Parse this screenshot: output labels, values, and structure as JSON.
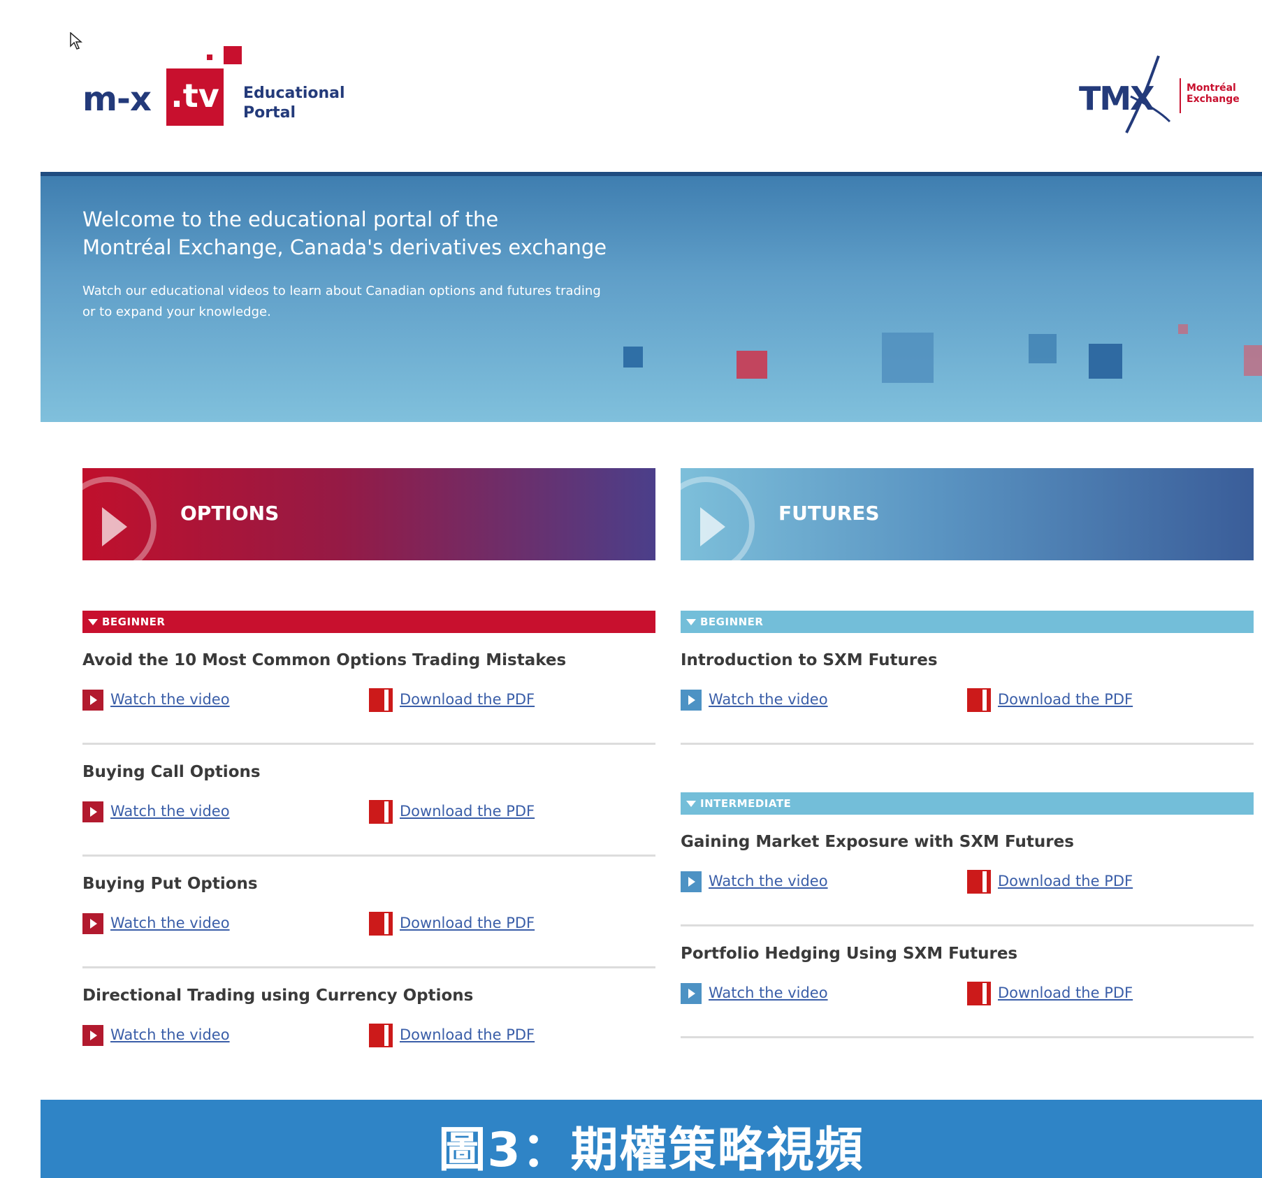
{
  "header": {
    "logo": {
      "main": "m-x",
      "tv": ".tv",
      "sub_line1": "Educational",
      "sub_line2": "Portal"
    },
    "tmx": {
      "main": "TMX",
      "sub_line1": "Montréal",
      "sub_line2": "Exchange"
    }
  },
  "hero": {
    "title_line1": "Welcome to the educational portal of the",
    "title_line2": "Montréal Exchange, Canada's derivatives exchange",
    "text": "Watch our educational videos to learn about Canadian options and futures trading or to expand your knowledge."
  },
  "options": {
    "banner_label": "OPTIONS",
    "level": "BEGINNER",
    "items": [
      {
        "title": "Avoid the 10 Most Common Options Trading Mistakes",
        "video": "Watch the video",
        "pdf": "Download the PDF"
      },
      {
        "title": "Buying Call Options",
        "video": "Watch the video",
        "pdf": "Download the PDF"
      },
      {
        "title": "Buying Put Options",
        "video": "Watch the video",
        "pdf": "Download the PDF"
      },
      {
        "title": "Directional Trading using Currency Options",
        "video": "Watch the video",
        "pdf": "Download the PDF"
      }
    ]
  },
  "futures": {
    "banner_label": "FUTURES",
    "level_beginner": "BEGINNER",
    "level_intermediate": "INTERMEDIATE",
    "beginner_items": [
      {
        "title": "Introduction to SXM Futures",
        "video": "Watch the video",
        "pdf": "Download the PDF"
      }
    ],
    "intermediate_items": [
      {
        "title": "Gaining Market Exposure with SXM Futures",
        "video": "Watch the video",
        "pdf": "Download the PDF"
      },
      {
        "title": "Portfolio Hedging Using SXM Futures",
        "video": "Watch the video",
        "pdf": "Download the PDF"
      }
    ]
  },
  "caption": {
    "text": "圖3：期權策略視頻"
  },
  "colors": {
    "red": "#c8102e",
    "navy": "#233a7a",
    "light_blue": "#73bed9",
    "caption_blue": "#2f84c6"
  }
}
